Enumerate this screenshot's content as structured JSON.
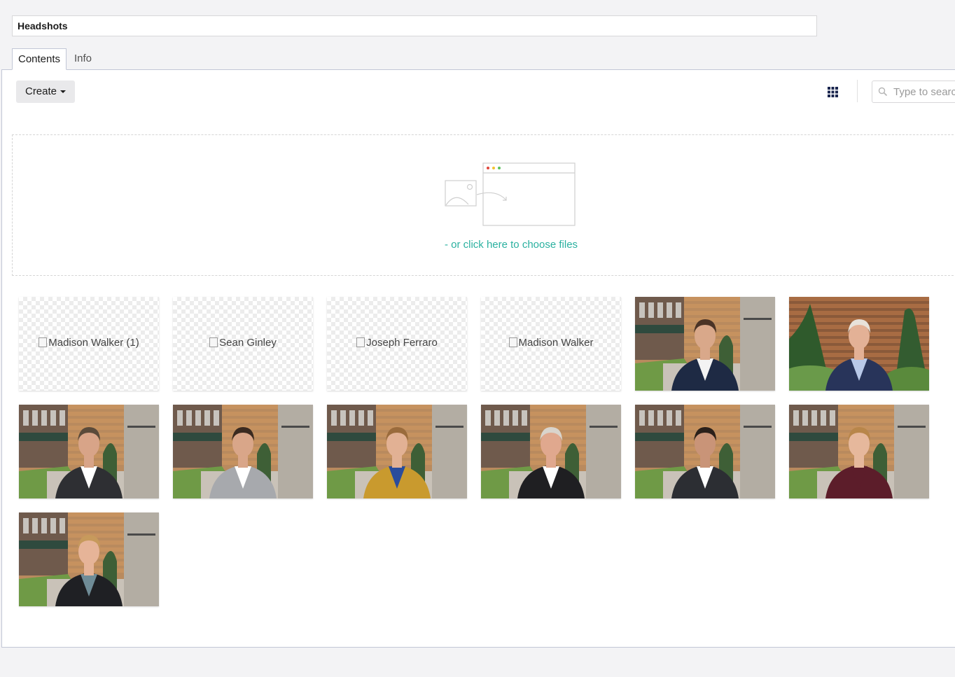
{
  "node": {
    "name": "Headshots"
  },
  "tabs": [
    {
      "label": "Contents",
      "active": true
    },
    {
      "label": "Info",
      "active": false
    }
  ],
  "toolbar": {
    "create_label": "Create",
    "view_icon": "grid-icon",
    "search_placeholder": "Type to search..."
  },
  "dropzone": {
    "link_text": "- or click here to choose files",
    "link_color": "#2bb1a0"
  },
  "media": [
    {
      "alt": "Madison Walker (1)",
      "broken": true
    },
    {
      "alt": "Sean Ginley",
      "broken": true
    },
    {
      "alt": "Joseph Ferraro",
      "broken": true
    },
    {
      "alt": "Madison Walker",
      "broken": true
    },
    {
      "alt": "",
      "broken": false,
      "subject": "woman-navy-blazer",
      "jacket": "#1e2a44",
      "shirt": "#f3f3f3",
      "hair": "#4a3326",
      "skin": "#d9a88a",
      "bg": "courtyard"
    },
    {
      "alt": "",
      "broken": false,
      "subject": "man-blue-suit",
      "jacket": "#28345a",
      "shirt": "#b8c8e8",
      "hair": "#e8e2da",
      "skin": "#e3b196",
      "bg": "garden"
    },
    {
      "alt": "",
      "broken": false,
      "subject": "man-dark-suit",
      "jacket": "#2e2f33",
      "shirt": "#ffffff",
      "hair": "#5a4a3a",
      "skin": "#d8a488",
      "bg": "courtyard"
    },
    {
      "alt": "",
      "broken": false,
      "subject": "man-grey-suit",
      "jacket": "#a7a9ad",
      "shirt": "#ffffff",
      "hair": "#3a2a20",
      "skin": "#d9a689",
      "bg": "courtyard"
    },
    {
      "alt": "",
      "broken": false,
      "subject": "woman-mustard-cardigan",
      "jacket": "#c99a2e",
      "shirt": "#2a4c9c",
      "hair": "#9a6b3c",
      "skin": "#e2b194",
      "bg": "courtyard"
    },
    {
      "alt": "",
      "broken": false,
      "subject": "man-black-suit",
      "jacket": "#1f1f22",
      "shirt": "#ffffff",
      "hair": "#d9d4cc",
      "skin": "#e0a88e",
      "bg": "courtyard"
    },
    {
      "alt": "",
      "broken": false,
      "subject": "man-charcoal-suit",
      "jacket": "#2c2e33",
      "shirt": "#ffffff",
      "hair": "#2a201a",
      "skin": "#c99478",
      "bg": "courtyard"
    },
    {
      "alt": "",
      "broken": false,
      "subject": "woman-burgundy-top",
      "jacket": "#5c1d2a",
      "shirt": "#5c1d2a",
      "hair": "#b8864a",
      "skin": "#e6b89c",
      "bg": "courtyard"
    },
    {
      "alt": "",
      "broken": false,
      "subject": "woman-black-cardigan",
      "jacket": "#1f2024",
      "shirt": "#6f8c97",
      "hair": "#c79a5c",
      "skin": "#e6b498",
      "bg": "courtyard"
    }
  ]
}
